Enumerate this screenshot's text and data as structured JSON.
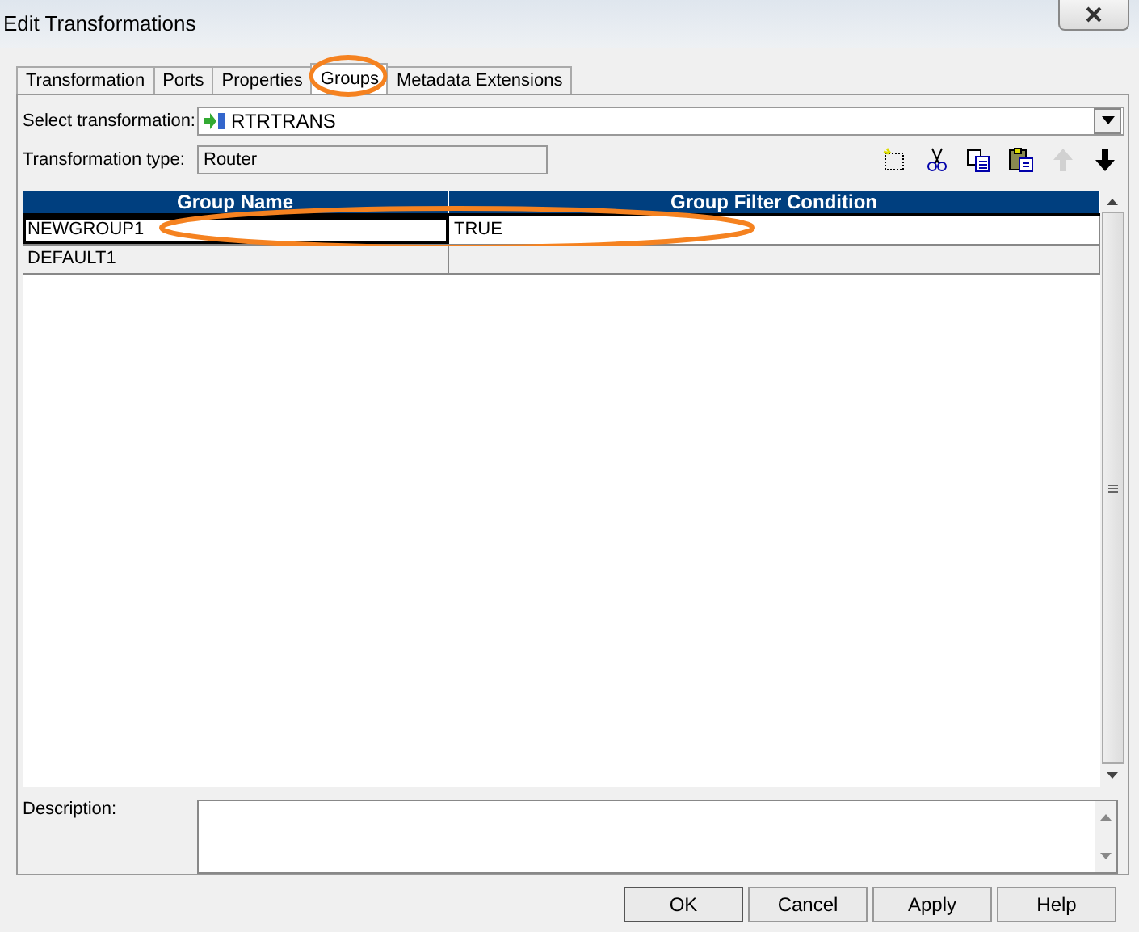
{
  "window": {
    "title": "Edit Transformations"
  },
  "tabs": [
    {
      "label": "Transformation",
      "selected": false,
      "circled": false
    },
    {
      "label": "Ports",
      "selected": false,
      "circled": false
    },
    {
      "label": "Properties",
      "selected": false,
      "circled": false
    },
    {
      "label": "Groups",
      "selected": true,
      "circled": true
    },
    {
      "label": "Metadata Extensions",
      "selected": false,
      "circled": false
    }
  ],
  "select_transformation": {
    "label": "Select transformation:",
    "value": "RTRTRANS"
  },
  "transformation_type": {
    "label": "Transformation type:",
    "value": "Router"
  },
  "toolbar": [
    {
      "kind": "new",
      "disabled": false
    },
    {
      "kind": "cut",
      "disabled": false
    },
    {
      "kind": "copy",
      "disabled": false
    },
    {
      "kind": "paste",
      "disabled": false
    },
    {
      "kind": "up",
      "disabled": true
    },
    {
      "kind": "down",
      "disabled": false
    }
  ],
  "table": {
    "columns": [
      "Group Name",
      "Group Filter Condition"
    ],
    "rows": [
      {
        "cells": [
          "NEWGROUP1",
          "TRUE"
        ],
        "selected": true,
        "circled": true
      },
      {
        "cells": [
          "DEFAULT1",
          ""
        ],
        "selected": false,
        "circled": false
      }
    ]
  },
  "description": {
    "label": "Description:"
  },
  "buttons": [
    "OK",
    "Cancel",
    "Apply",
    "Help"
  ]
}
